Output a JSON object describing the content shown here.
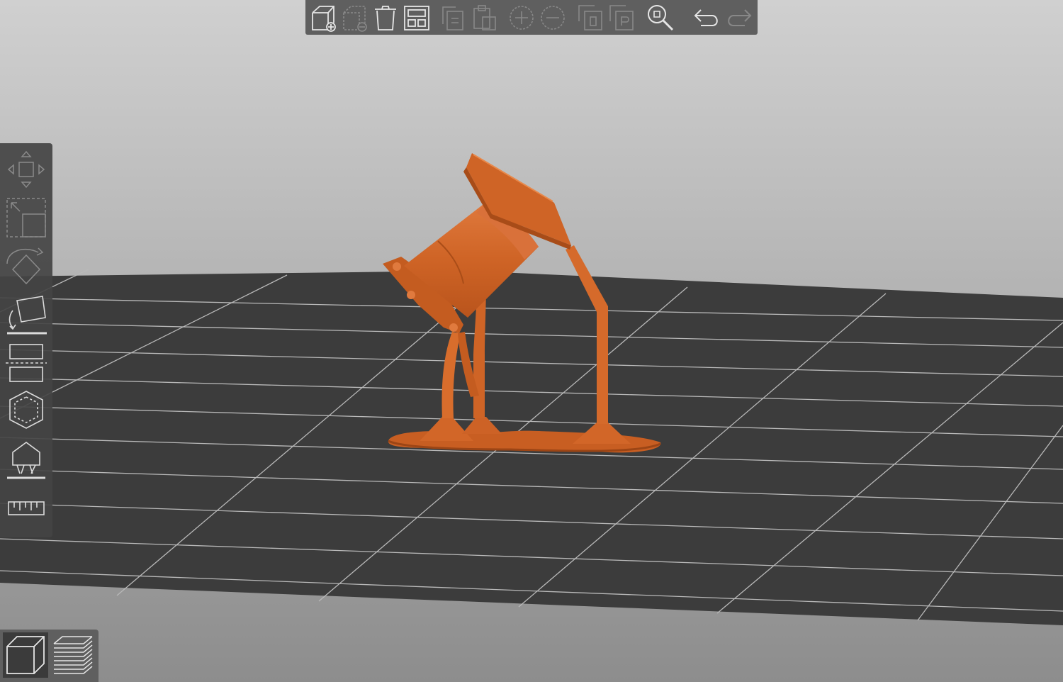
{
  "app": {
    "accent": "#d66a2e",
    "bed_color": "#3c3c3c",
    "grid_color": "#bdbdbd"
  },
  "top_toolbar": {
    "buttons": [
      {
        "name": "add-object-button",
        "icon": "cube-add-icon",
        "enabled": true
      },
      {
        "name": "delete-object-button",
        "icon": "cube-remove-icon",
        "enabled": false
      },
      {
        "name": "delete-all-button",
        "icon": "trash-icon",
        "enabled": true
      },
      {
        "name": "arrange-button",
        "icon": "arrange-icon",
        "enabled": true
      },
      {
        "name": "copy-button",
        "icon": "copy-icon",
        "enabled": false
      },
      {
        "name": "paste-button",
        "icon": "paste-icon",
        "enabled": false
      },
      {
        "name": "add-instance-button",
        "icon": "plus-icon",
        "enabled": false
      },
      {
        "name": "remove-instance-button",
        "icon": "minus-icon",
        "enabled": false
      },
      {
        "name": "split-objects-button",
        "icon": "split-objects-icon",
        "enabled": false
      },
      {
        "name": "split-parts-button",
        "icon": "split-parts-icon",
        "enabled": false
      },
      {
        "name": "search-button",
        "icon": "search-icon",
        "enabled": true
      },
      {
        "name": "undo-button",
        "icon": "undo-icon",
        "enabled": true
      },
      {
        "name": "redo-button",
        "icon": "redo-icon",
        "enabled": false
      }
    ]
  },
  "left_toolbar": {
    "tools": [
      {
        "name": "move-tool",
        "icon": "move-icon",
        "enabled": false
      },
      {
        "name": "scale-tool",
        "icon": "scale-icon",
        "enabled": false
      },
      {
        "name": "rotate-tool",
        "icon": "rotate-icon",
        "enabled": false
      },
      {
        "name": "place-on-face-tool",
        "icon": "place-on-face-icon",
        "enabled": true
      },
      {
        "name": "cut-tool",
        "icon": "cut-icon",
        "enabled": true
      },
      {
        "name": "hollow-tool",
        "icon": "hollow-icon",
        "enabled": true
      },
      {
        "name": "support-points-tool",
        "icon": "support-points-icon",
        "enabled": true
      },
      {
        "name": "measure-tool",
        "icon": "ruler-icon",
        "enabled": true
      }
    ]
  },
  "view_switch": {
    "items": [
      {
        "name": "3d-view-tab",
        "icon": "cube-icon",
        "active": true
      },
      {
        "name": "preview-tab",
        "icon": "layers-icon",
        "active": false
      }
    ]
  }
}
